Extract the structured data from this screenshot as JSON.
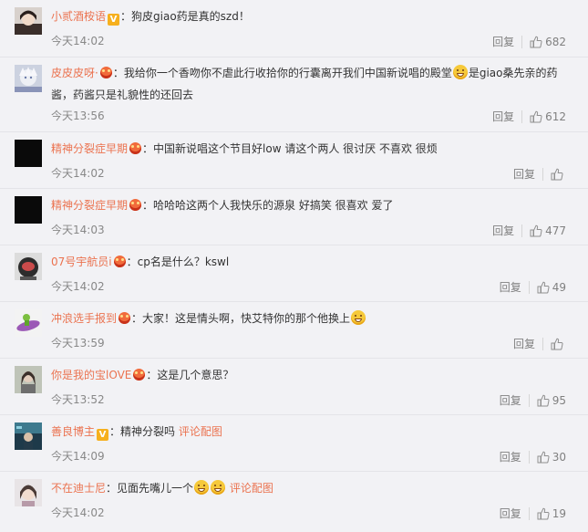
{
  "comments": [
    {
      "username": "小贰酒桉语",
      "badge": "v",
      "text": "：狗皮giao药是真的szd！",
      "time": "今天14:02",
      "reply_label": "回复",
      "likes": "682"
    },
    {
      "username": "皮皮皮呀·",
      "badge": "crown",
      "text_part1": "：我给你一个香吻你不虐此行收拾你的行囊离开我们中国新说唱的殿堂",
      "emoji": "doge",
      "text_part2": "是giao桑先亲的药酱，药酱只是礼貌性的还回去",
      "time": "今天13:56",
      "reply_label": "回复",
      "likes": "612"
    },
    {
      "username": "精神分裂症早期",
      "badge": "crown",
      "text": "：中国新说唱这个节目好low 请这个两人 很讨厌 不喜欢 很烦",
      "time": "今天14:02",
      "reply_label": "回复",
      "likes": ""
    },
    {
      "username": "精神分裂症早期",
      "badge": "crown",
      "text": "：哈哈哈这两个人我快乐的源泉 好搞笑 很喜欢 爱了",
      "time": "今天14:03",
      "reply_label": "回复",
      "likes": "477"
    },
    {
      "username": "07号宇航员i",
      "badge": "crown",
      "text": "：cp名是什么？kswl",
      "time": "今天14:02",
      "reply_label": "回复",
      "likes": "49"
    },
    {
      "username": "冲浪选手报到",
      "badge": "crown",
      "text": "：大家！这是情头啊，快艾特你的那个他换上",
      "emoji": "doge",
      "time": "今天13:59",
      "reply_label": "回复",
      "likes": ""
    },
    {
      "username": "你是我的宝lOVE",
      "badge": "crown",
      "text": "：这是几个意思？",
      "time": "今天13:52",
      "reply_label": "回复",
      "likes": "95"
    },
    {
      "username": "善良博主",
      "badge": "v",
      "text": "：精神分裂吗",
      "link": "评论配图",
      "time": "今天14:09",
      "reply_label": "回复",
      "likes": "30"
    },
    {
      "username": "不在迪士尼",
      "text": "：见面先嘴儿一个",
      "emoji": "grin",
      "link": "评论配图",
      "time": "今天14:02",
      "reply_label": "回复",
      "likes": "19"
    }
  ]
}
